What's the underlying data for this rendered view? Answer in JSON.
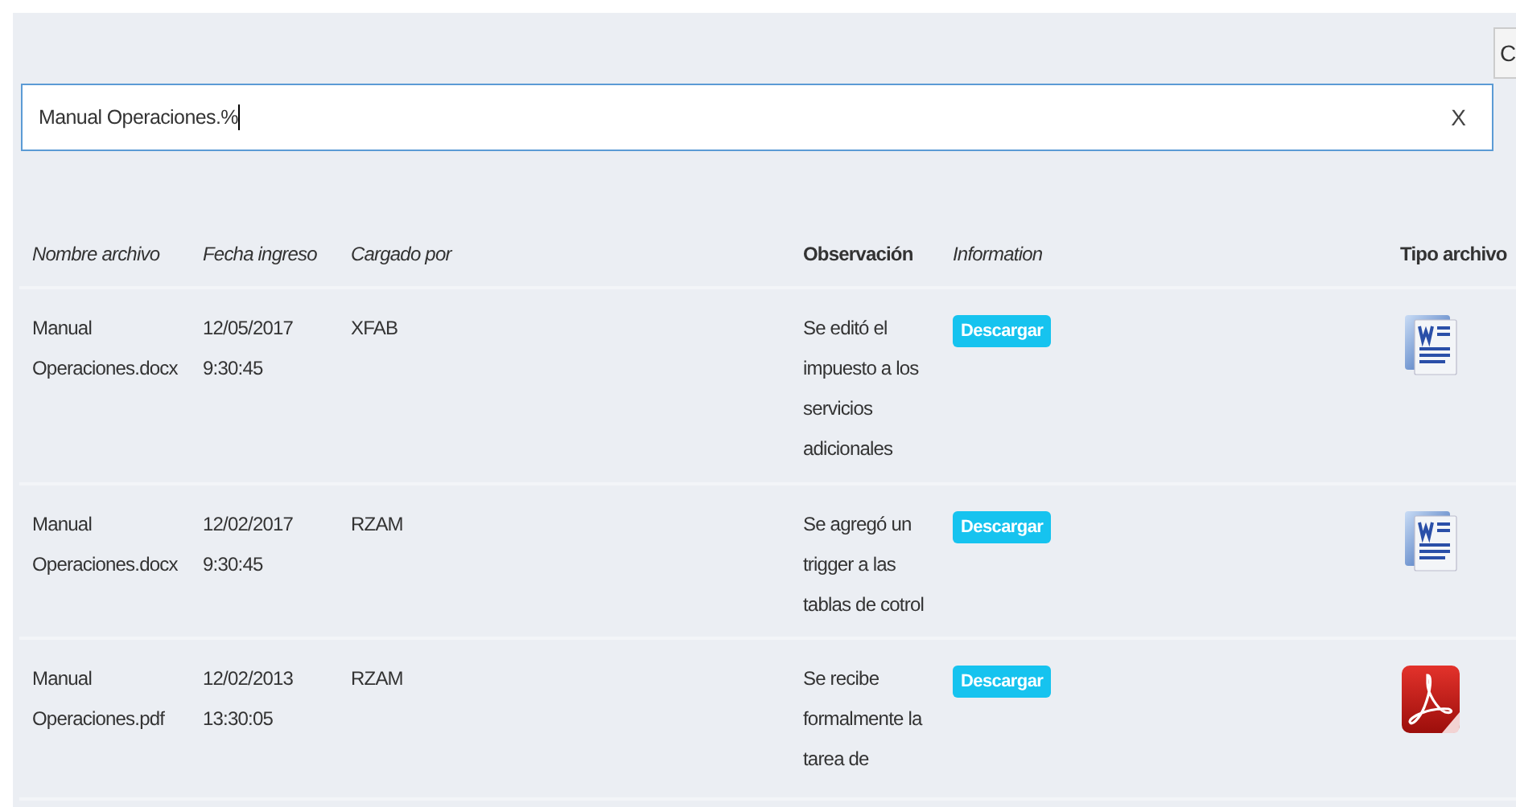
{
  "top_button": {
    "label": "C"
  },
  "search": {
    "value": "Manual Operaciones.%",
    "clear_label": "X"
  },
  "table": {
    "columns": [
      {
        "label": "Nombre archivo",
        "kind": "italic"
      },
      {
        "label": "Fecha ingreso",
        "kind": "italic"
      },
      {
        "label": "Cargado por",
        "kind": "italic"
      },
      {
        "label": "Observación",
        "kind": "bold"
      },
      {
        "label": "Information",
        "kind": "italic"
      },
      {
        "label": "Tipo archivo",
        "kind": "bold"
      }
    ],
    "rows": [
      {
        "name": "Manual Operaciones.docx",
        "date": "12/05/2017 9:30:45",
        "uploaded_by": "XFAB",
        "observation": "Se editó el impuesto a los servicios adicionales",
        "action": "Descargar",
        "kind": "word"
      },
      {
        "name": "Manual Operaciones.docx",
        "date": "12/02/2017 9:30:45",
        "uploaded_by": "RZAM",
        "observation": "Se agregó un trigger a las tablas de cotrol",
        "action": "Descargar",
        "kind": "word"
      },
      {
        "name": "Manual Operaciones.pdf",
        "date": "12/02/2013 13:30:05",
        "uploaded_by": "RZAM",
        "observation": "Se recibe formalmente la tarea de",
        "action": "Descargar",
        "kind": "pdf"
      }
    ]
  }
}
